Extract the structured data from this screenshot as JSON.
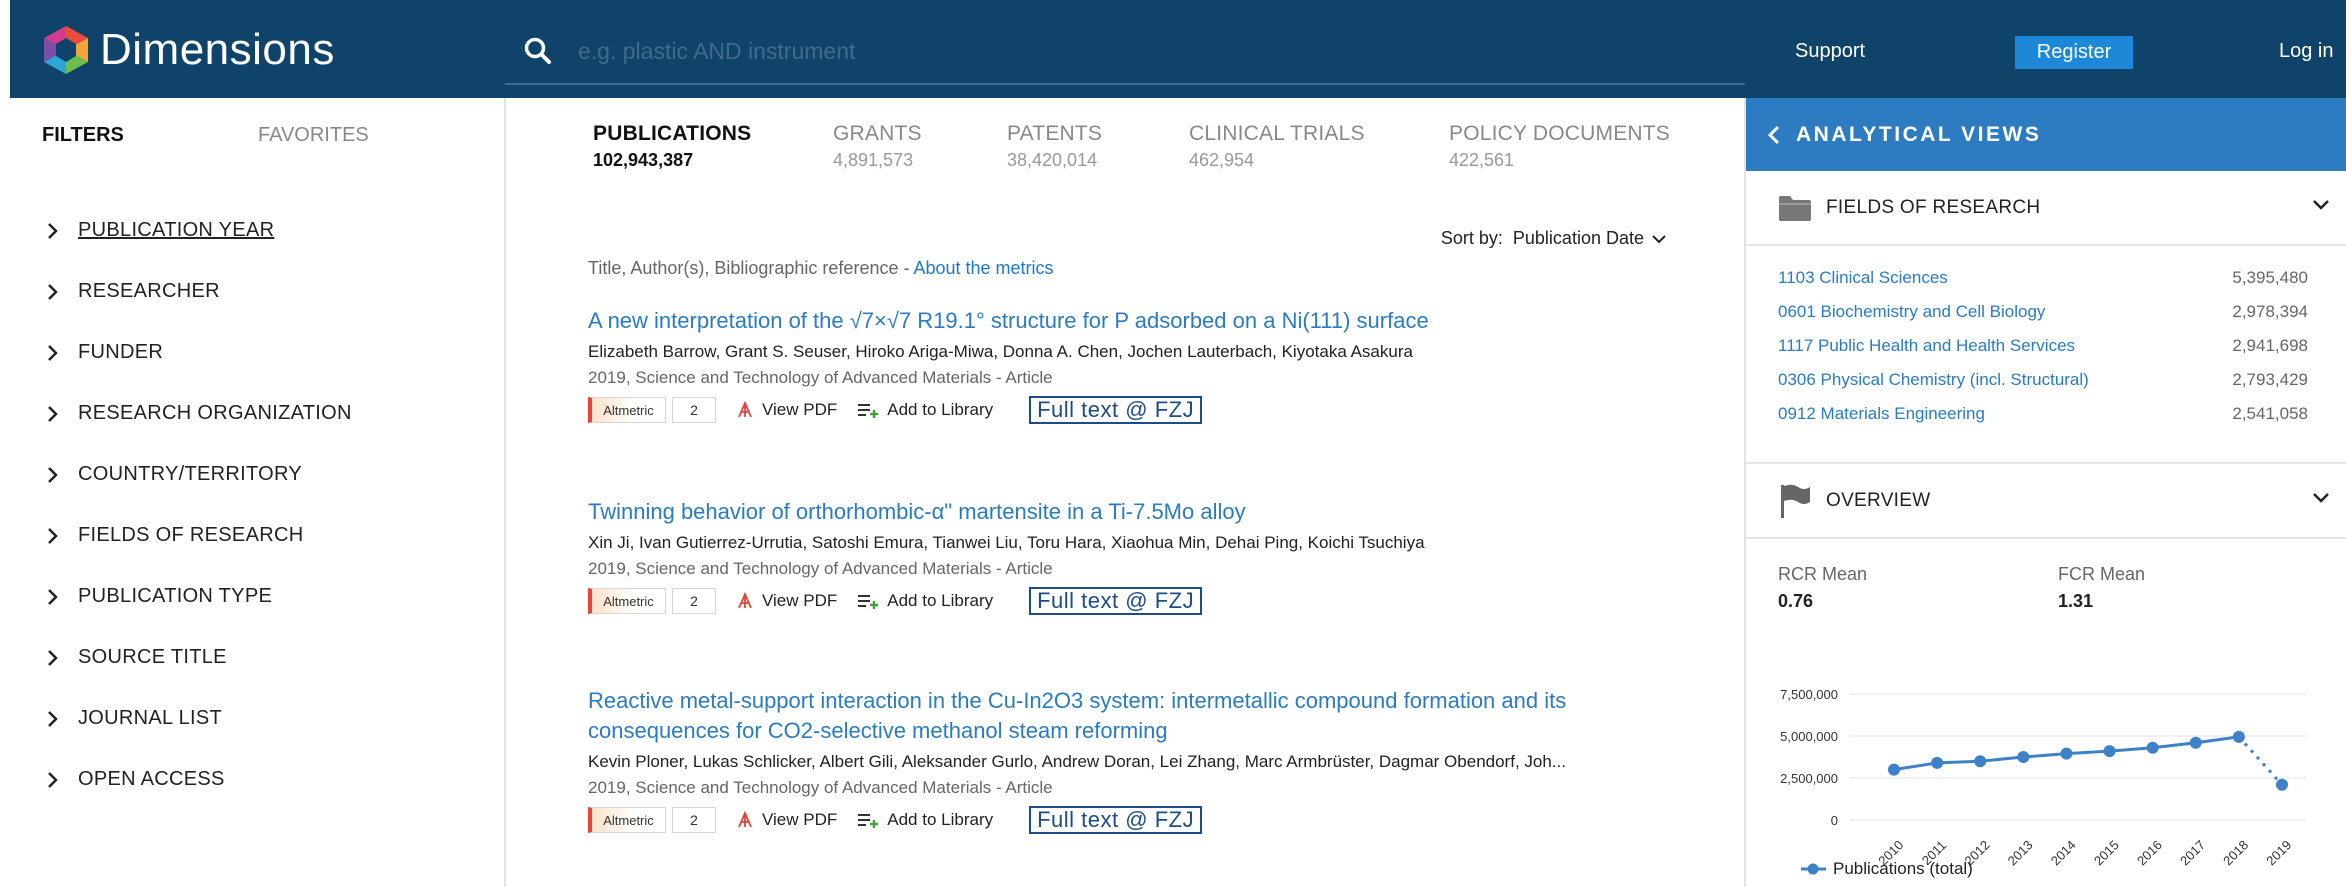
{
  "app": {
    "brand": "Dimensions"
  },
  "search": {
    "placeholder": "e.g. plastic AND instrument"
  },
  "header": {
    "support": "Support",
    "register": "Register",
    "login": "Log in"
  },
  "sidebar": {
    "tabs": [
      "FILTERS",
      "FAVORITES"
    ],
    "filters": [
      "PUBLICATION YEAR",
      "RESEARCHER",
      "FUNDER",
      "RESEARCH ORGANIZATION",
      "COUNTRY/TERRITORY",
      "FIELDS OF RESEARCH",
      "PUBLICATION TYPE",
      "SOURCE TITLE",
      "JOURNAL LIST",
      "OPEN ACCESS"
    ]
  },
  "types": [
    {
      "label": "PUBLICATIONS",
      "count": "102,943,387"
    },
    {
      "label": "GRANTS",
      "count": "4,891,573"
    },
    {
      "label": "PATENTS",
      "count": "38,420,014"
    },
    {
      "label": "CLINICAL TRIALS",
      "count": "462,954"
    },
    {
      "label": "POLICY DOCUMENTS",
      "count": "422,561"
    }
  ],
  "sort": {
    "label": "Sort by:",
    "value": "Publication Date"
  },
  "meta": {
    "text": "Title, Author(s), Bibliographic reference - ",
    "link": "About the metrics"
  },
  "results": [
    {
      "title": "A new interpretation of the √7×√7 R19.1° structure for P adsorbed on a Ni(111) surface",
      "authors": "Elizabeth Barrow, Grant S. Seuser, Hiroko Ariga-Miwa, Donna A. Chen, Jochen Lauterbach, Kiyotaka Asakura",
      "source": "2019, Science and Technology of Advanced Materials - Article",
      "altmetric": "Altmetric",
      "score": "2",
      "view_pdf": "View PDF",
      "add_library": "Add to Library",
      "fulltext": "Full text @ FZJ"
    },
    {
      "title": "Twinning behavior of orthorhombic-α\" martensite in a Ti-7.5Mo alloy",
      "authors": "Xin Ji, Ivan Gutierrez-Urrutia, Satoshi Emura, Tianwei Liu, Toru Hara, Xiaohua Min, Dehai Ping, Koichi Tsuchiya",
      "source": "2019, Science and Technology of Advanced Materials - Article",
      "altmetric": "Altmetric",
      "score": "2",
      "view_pdf": "View PDF",
      "add_library": "Add to Library",
      "fulltext": "Full text @ FZJ"
    },
    {
      "title": "Reactive metal-support interaction in the Cu-In2O3 system: intermetallic compound formation and its consequences for CO2-selective methanol steam reforming",
      "authors": "Kevin Ploner, Lukas Schlicker, Albert Gili, Aleksander Gurlo, Andrew Doran, Lei Zhang, Marc Armbrüster, Dagmar Obendorf, Joh...",
      "source": "2019, Science and Technology of Advanced Materials - Article",
      "altmetric": "Altmetric",
      "score": "2",
      "view_pdf": "View PDF",
      "add_library": "Add to Library",
      "fulltext": "Full text @ FZJ"
    }
  ],
  "panel": {
    "title": "ANALYTICAL VIEWS",
    "fields_title": "FIELDS OF RESEARCH",
    "fields": [
      {
        "label": "1103 Clinical Sciences",
        "count": "5,395,480"
      },
      {
        "label": "0601 Biochemistry and Cell Biology",
        "count": "2,978,394"
      },
      {
        "label": "1117 Public Health and Health Services",
        "count": "2,941,698"
      },
      {
        "label": "0306 Physical Chemistry (incl. Structural)",
        "count": "2,793,429"
      },
      {
        "label": "0912 Materials Engineering",
        "count": "2,541,058"
      }
    ],
    "overview_title": "OVERVIEW",
    "rcr_label": "RCR Mean",
    "rcr_value": "0.76",
    "fcr_label": "FCR Mean",
    "fcr_value": "1.31"
  },
  "chart_data": {
    "type": "line",
    "x": [
      "2010",
      "2011",
      "2012",
      "2013",
      "2014",
      "2015",
      "2016",
      "2017",
      "2018",
      "2019"
    ],
    "series": [
      {
        "name": "Publications (total)",
        "values": [
          3000000,
          3400000,
          3500000,
          3750000,
          3950000,
          4100000,
          4300000,
          4600000,
          4950000,
          2100000
        ]
      }
    ],
    "ylim": [
      0,
      7500000
    ],
    "yticks": [
      "7,500,000",
      "5,000,000",
      "2,500,000",
      "0"
    ],
    "ytick_values": [
      7500000,
      5000000,
      2500000,
      0
    ],
    "partial_last_point": true,
    "color": "#3d82c8"
  },
  "colors": {
    "header": "#0f4369",
    "accent": "#1e88d8",
    "link": "#2b7bc3",
    "panel_header": "#2d7cc1"
  }
}
